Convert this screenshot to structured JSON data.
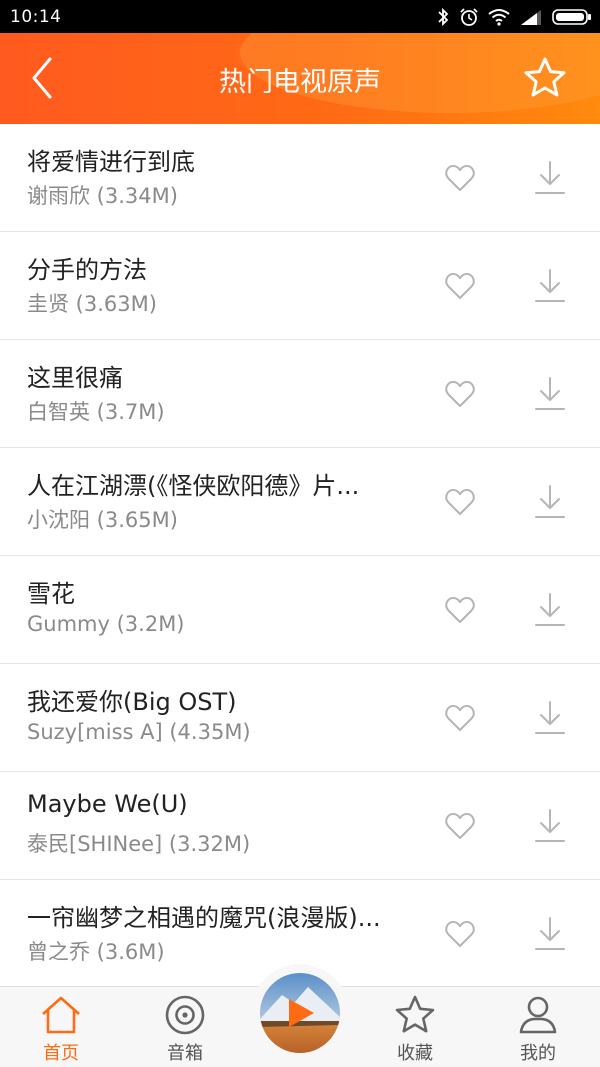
{
  "status_bar": {
    "time": "10:14"
  },
  "header": {
    "title": "热门电视原声"
  },
  "songs": [
    {
      "title": "将爱情进行到底",
      "subtitle": "谢雨欣 (3.34M)"
    },
    {
      "title": "分手的方法",
      "subtitle": "圭贤 (3.63M)"
    },
    {
      "title": "这里很痛",
      "subtitle": "白智英 (3.7M)"
    },
    {
      "title": "人在江湖漂(《怪侠欧阳德》片...",
      "subtitle": "小沈阳 (3.65M)"
    },
    {
      "title": "雪花",
      "subtitle": "Gummy (3.2M)"
    },
    {
      "title": "我还爱你(Big OST)",
      "subtitle": "Suzy[miss A] (4.35M)"
    },
    {
      "title": "Maybe We(U)",
      "subtitle": "泰民[SHINee] (3.32M)"
    },
    {
      "title": "一帘幽梦之相遇的魔咒(浪漫版)...",
      "subtitle": "曾之乔 (3.6M)"
    }
  ],
  "nav": {
    "items": [
      {
        "label": "首页",
        "icon": "home-icon",
        "active": true
      },
      {
        "label": "音箱",
        "icon": "speaker-icon",
        "active": false
      },
      {
        "label": "收藏",
        "icon": "star-icon",
        "active": false
      },
      {
        "label": "我的",
        "icon": "user-icon",
        "active": false
      }
    ]
  },
  "colors": {
    "accent": "#ff6a14",
    "header_start": "#ff5a1f",
    "header_end": "#ff8a0d",
    "icon_gray": "#b5b5b5"
  }
}
